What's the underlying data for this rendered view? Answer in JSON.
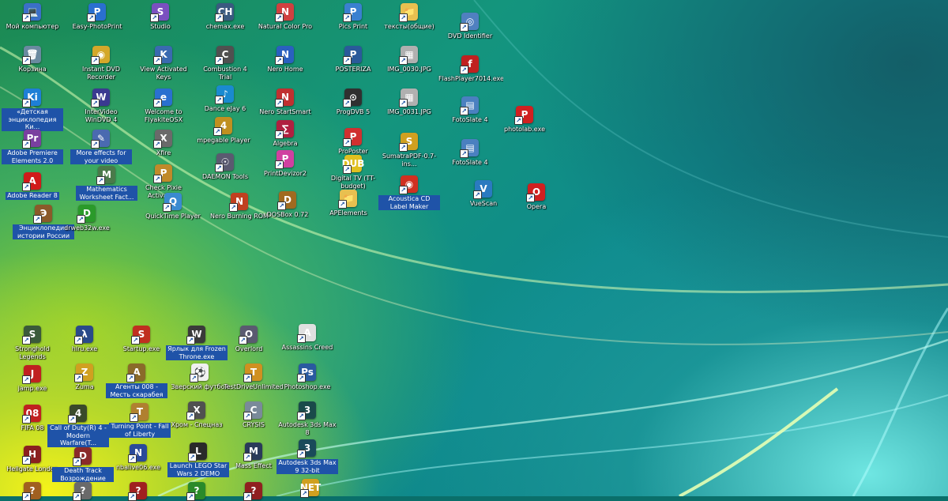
{
  "desktop": {
    "icons": [
      {
        "label": "Мой компьютер",
        "glyph": "💻",
        "color": "#3b6fc8",
        "selected": false
      },
      {
        "label": "Корзина",
        "glyph": "🗑",
        "color": "#6a8aa0",
        "selected": false
      },
      {
        "label": "«Детская энциклопедия Ки...",
        "glyph": "Ki",
        "color": "#1e7fd6",
        "selected": true
      },
      {
        "label": "Adobe Premiere Elements 2.0",
        "glyph": "Pr",
        "color": "#7a3fa0",
        "selected": true
      },
      {
        "label": "Adobe Reader 8",
        "glyph": "A",
        "color": "#d11a1a",
        "selected": true
      },
      {
        "label": "Энциклопедия истории России",
        "glyph": "Э",
        "color": "#8a5a2a",
        "selected": true
      },
      {
        "label": "Easy-PhotoPrint",
        "glyph": "P",
        "color": "#2a6fd0",
        "selected": false
      },
      {
        "label": "Instant DVD Recorder",
        "glyph": "◉",
        "color": "#d4a82a",
        "selected": false
      },
      {
        "label": "InterVideo WinDVD 4",
        "glyph": "W",
        "color": "#3a3a90",
        "selected": false
      },
      {
        "label": "More effects for your video",
        "glyph": "✎",
        "color": "#4a6ab0",
        "selected": true
      },
      {
        "label": "Mathematics Worksheet Fact...",
        "glyph": "M",
        "color": "#4a7a4a",
        "selected": true
      },
      {
        "label": "drweb32w.exe",
        "glyph": "D",
        "color": "#2a9a2a",
        "selected": false
      },
      {
        "label": "Studio",
        "glyph": "S",
        "color": "#7a50c0",
        "selected": false
      },
      {
        "label": "View Activated Keys",
        "glyph": "K",
        "color": "#3a6ab0",
        "selected": false
      },
      {
        "label": "Welcome to FlyakiteOSX",
        "glyph": "e",
        "color": "#2a70d0",
        "selected": false
      },
      {
        "label": "Xfire",
        "glyph": "X",
        "color": "#6a6a6a",
        "selected": false
      },
      {
        "label": "Check Pixie Activation",
        "glyph": "P",
        "color": "#c08a2a",
        "selected": false
      },
      {
        "label": "QuickTime Player",
        "glyph": "Q",
        "color": "#3a8ad0",
        "selected": false
      },
      {
        "label": "chemax.exe",
        "glyph": "CH",
        "color": "#3a5a80",
        "selected": false
      },
      {
        "label": "Combustion 4 Trial",
        "glyph": "C",
        "color": "#505050",
        "selected": false
      },
      {
        "label": "Dance eJay 6",
        "glyph": "♪",
        "color": "#1a8ad0",
        "selected": false
      },
      {
        "label": "mpegable Player",
        "glyph": "4",
        "color": "#c09020",
        "selected": false
      },
      {
        "label": "DAEMON Tools",
        "glyph": "☉",
        "color": "#5a5a70",
        "selected": false
      },
      {
        "label": "Nero Burning ROM",
        "glyph": "N",
        "color": "#c04020",
        "selected": false
      },
      {
        "label": "Natural Color Pro",
        "glyph": "N",
        "color": "#d04040",
        "selected": false
      },
      {
        "label": "Nero Home",
        "glyph": "N",
        "color": "#2a60c0",
        "selected": false
      },
      {
        "label": "Nero StartSmart",
        "glyph": "N",
        "color": "#c03030",
        "selected": false
      },
      {
        "label": "Algebra",
        "glyph": "∑",
        "color": "#b02040",
        "selected": false
      },
      {
        "label": "PrintDevizor2",
        "glyph": "P",
        "color": "#d040a0",
        "selected": false
      },
      {
        "label": "DOSBox 0.72",
        "glyph": "D",
        "color": "#a06a20",
        "selected": false
      },
      {
        "label": "Pics Print",
        "glyph": "P",
        "color": "#3a80d0",
        "selected": false
      },
      {
        "label": "POSTERIZA",
        "glyph": "P",
        "color": "#2a5a9a",
        "selected": false
      },
      {
        "label": "ProgDVB 5",
        "glyph": "⊙",
        "color": "#303030",
        "selected": false
      },
      {
        "label": "ProPoster",
        "glyph": "P",
        "color": "#d03030",
        "selected": false
      },
      {
        "label": "Digital TV (TT-budget)",
        "glyph": "DUB",
        "color": "#e0c020",
        "selected": false
      },
      {
        "label": "APElements",
        "glyph": "📁",
        "color": "#e8c050",
        "selected": false
      },
      {
        "label": "тексты(общие)",
        "glyph": "📁",
        "color": "#e8c050",
        "selected": false
      },
      {
        "label": "IMG_0030.JPG",
        "glyph": "▦",
        "color": "#b0b0b0",
        "selected": false
      },
      {
        "label": "IMG_0031.JPG",
        "glyph": "▦",
        "color": "#b0b0b0",
        "selected": false
      },
      {
        "label": "SumatraPDF-0.7-ins...",
        "glyph": "S",
        "color": "#d0a020",
        "selected": false
      },
      {
        "label": "Acoustica CD Label Maker",
        "glyph": "◉",
        "color": "#d03020",
        "selected": true
      },
      {
        "label": "DVD Identifier",
        "glyph": "◎",
        "color": "#5080c0",
        "selected": false
      },
      {
        "label": "FlashPlayer7014.exe",
        "glyph": "f",
        "color": "#c02020",
        "selected": false
      },
      {
        "label": "FotoSlate 4",
        "glyph": "▤",
        "color": "#4a80c0",
        "selected": false
      },
      {
        "label": "FotoSlate 4",
        "glyph": "▤",
        "color": "#4a80c0",
        "selected": false
      },
      {
        "label": "VueScan",
        "glyph": "V",
        "color": "#2a7ac0",
        "selected": false
      },
      {
        "label": "photolab.exe",
        "glyph": "P",
        "color": "#d02020",
        "selected": false
      },
      {
        "label": "Opera",
        "glyph": "O",
        "color": "#d02020",
        "selected": false
      },
      {
        "label": "Stronghold Legends",
        "glyph": "S",
        "color": "#3a5a3a",
        "selected": false
      },
      {
        "label": "jamp.exe",
        "glyph": "J",
        "color": "#c02020",
        "selected": false
      },
      {
        "label": "FIFA 08",
        "glyph": "08",
        "color": "#c02020",
        "selected": false
      },
      {
        "label": "Hellgate London",
        "glyph": "H",
        "color": "#8a2020",
        "selected": false
      },
      {
        "label": "hlru.exe",
        "glyph": "λ",
        "color": "#2a4a8a",
        "selected": false
      },
      {
        "label": "Zuma",
        "glyph": "Z",
        "color": "#d0a020",
        "selected": false
      },
      {
        "label": "Call of Duty(R) 4 - Modern Warfare(T...",
        "glyph": "4",
        "color": "#3a4a2a",
        "selected": true
      },
      {
        "label": "Death Track Возрождение",
        "glyph": "D",
        "color": "#8a2a2a",
        "selected": true
      },
      {
        "label": "Startup.exe",
        "glyph": "S",
        "color": "#c03020",
        "selected": false
      },
      {
        "label": "Агенты 008 - Месть скарабея",
        "glyph": "A",
        "color": "#8a6a2a",
        "selected": true
      },
      {
        "label": "Turning Point - Fall of Liberty",
        "glyph": "T",
        "color": "#b08030",
        "selected": true
      },
      {
        "label": "nbalive06.exe",
        "glyph": "N",
        "color": "#2a4a9a",
        "selected": false
      },
      {
        "label": "Ярлык для Frozen Throne.exe",
        "glyph": "W",
        "color": "#3a3a3a",
        "selected": true
      },
      {
        "label": "Зверский футбол",
        "glyph": "⚽",
        "color": "#f0f0f0",
        "selected": false
      },
      {
        "label": "Хром - Спецназ",
        "glyph": "X",
        "color": "#505050",
        "selected": false
      },
      {
        "label": "Launch LEGO Star Wars 2 DEMO",
        "glyph": "L",
        "color": "#2a2a2a",
        "selected": true
      },
      {
        "label": "Overlord",
        "glyph": "O",
        "color": "#5a5a70",
        "selected": false
      },
      {
        "label": "TestDriveUnlimited",
        "glyph": "T",
        "color": "#d09020",
        "selected": false
      },
      {
        "label": "CRYSIS",
        "glyph": "C",
        "color": "#7a8a9a",
        "selected": false
      },
      {
        "label": "Mass Effect",
        "glyph": "M",
        "color": "#2a3a5a",
        "selected": false
      },
      {
        "label": "Assassins Creed",
        "glyph": "A",
        "color": "#e0e0e0",
        "selected": false
      },
      {
        "label": "Photoshop.exe",
        "glyph": "Ps",
        "color": "#2a5aa0",
        "selected": false
      },
      {
        "label": "Autodesk 3ds Max 8",
        "glyph": "3",
        "color": "#1a4a4a",
        "selected": false
      },
      {
        "label": "Autodesk 3ds Max 9 32-bit",
        "glyph": "3",
        "color": "#1a4a5a",
        "selected": true
      },
      {
        "label": "",
        "glyph": "?",
        "color": "#a06020",
        "selected": false
      },
      {
        "label": "",
        "glyph": "?",
        "color": "#6a6a6a",
        "selected": false
      },
      {
        "label": "",
        "glyph": "?",
        "color": "#a02020",
        "selected": false
      },
      {
        "label": "",
        "glyph": "?",
        "color": "#2a8a2a",
        "selected": false
      },
      {
        "label": "",
        "glyph": "?",
        "color": "#902020",
        "selected": false
      },
      {
        "label": "",
        "glyph": "NET",
        "color": "#d0a020",
        "selected": false
      }
    ]
  }
}
